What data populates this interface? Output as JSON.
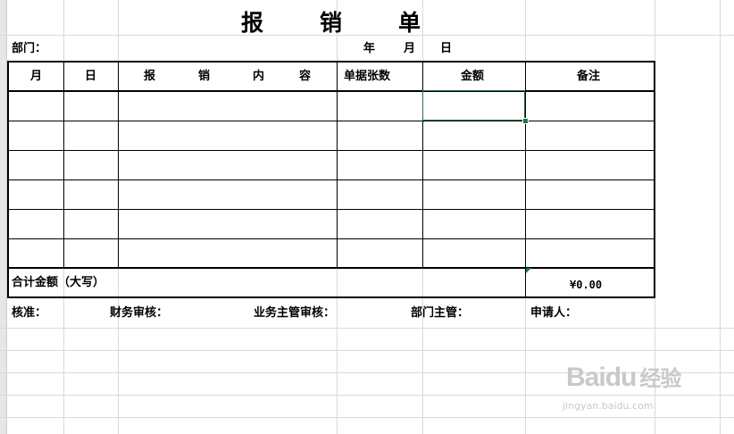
{
  "form": {
    "title": [
      "报",
      "销",
      "单"
    ],
    "department_label": "部门：",
    "date_labels": {
      "year": "年",
      "month": "月",
      "day": "日"
    }
  },
  "table": {
    "headers": [
      "月",
      "日",
      "报",
      "销",
      "内",
      "容",
      "单据张数",
      "金额",
      "备注"
    ],
    "rows": 6,
    "total_label": "合计金额（大写）",
    "total_value": "¥0.00"
  },
  "signatures": [
    "核准：",
    "财务审核：",
    "业务主管审核：",
    "部门主管：",
    "申请人："
  ],
  "watermark": {
    "logo": "Bai",
    "logo2": "du",
    "logo3": "经验",
    "url": "jingyan.baidu.com"
  },
  "colors": {
    "accent": "#217346",
    "grid": "#d9d9d9"
  }
}
